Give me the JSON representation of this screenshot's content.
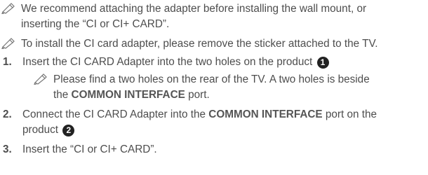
{
  "notes": {
    "note1": {
      "line1": "We recommend attaching the adapter before installing the wall mount, or",
      "line2": "inserting the “CI or CI+ CARD”."
    },
    "note2": {
      "line1": "To install the CI card adapter, please remove the sticker attached to the TV."
    }
  },
  "steps": [
    {
      "number": "1.",
      "line1_pre": "Insert the CI CARD Adapter into the two holes on the product",
      "badge": "1",
      "subnote": {
        "line1": "Please find a two holes on the rear of the TV. A two holes is beside",
        "line2_pre": "the",
        "line2_bold": "COMMON INTERFACE",
        "line2_post": "port."
      }
    },
    {
      "number": "2.",
      "line1_pre": "Connect the CI CARD Adapter into the",
      "line1_bold": "COMMON INTERFACE",
      "line1_post": "port on the",
      "line2_pre": "product",
      "badge": "2"
    },
    {
      "number": "3.",
      "line1": "Insert the “CI or CI+ CARD”."
    }
  ],
  "icon": "note-pencil-icon"
}
